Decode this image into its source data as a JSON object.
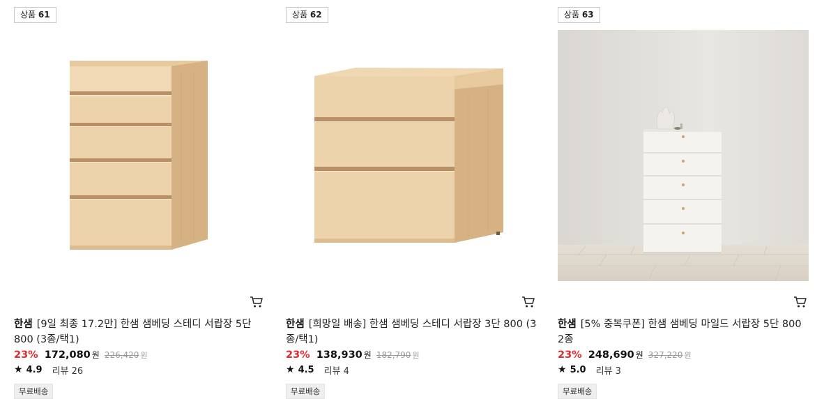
{
  "products": [
    {
      "rank_prefix": "상품",
      "rank_number": "61",
      "brand": "한샘",
      "title": "[9일 최종 17.2만] 한샘 샘베딩 스테디 서랍장 5단 800 (3종/택1)",
      "discount": "23%",
      "price": "172,080",
      "currency": "원",
      "original_price": "226,420",
      "original_currency": "원",
      "star_icon": "★",
      "rating": "4.9",
      "review_label": "리뷰 26",
      "badge": "무료배송",
      "cart_icon": "cart-icon"
    },
    {
      "rank_prefix": "상품",
      "rank_number": "62",
      "brand": "한샘",
      "title": "[희망일 배송] 한샘 샘베딩 스테디 서랍장 3단 800 (3종/택1)",
      "discount": "23%",
      "price": "138,930",
      "currency": "원",
      "original_price": "182,790",
      "original_currency": "원",
      "star_icon": "★",
      "rating": "4.5",
      "review_label": "리뷰 4",
      "badge": "무료배송",
      "cart_icon": "cart-icon"
    },
    {
      "rank_prefix": "상품",
      "rank_number": "63",
      "brand": "한샘",
      "title": "[5% 중복쿠폰] 한샘 샘베딩 마일드 서랍장 5단 800 2종",
      "discount": "23%",
      "price": "248,690",
      "currency": "원",
      "original_price": "327,220",
      "original_currency": "원",
      "star_icon": "★",
      "rating": "5.0",
      "review_label": "리뷰 3",
      "badge": "무료배송",
      "cart_icon": "cart-icon"
    }
  ],
  "colors": {
    "discount": "#e5292d",
    "wood_light": "#ecd3ab",
    "wood_dark": "#d8b888",
    "white_dresser": "#f4f3f0"
  }
}
